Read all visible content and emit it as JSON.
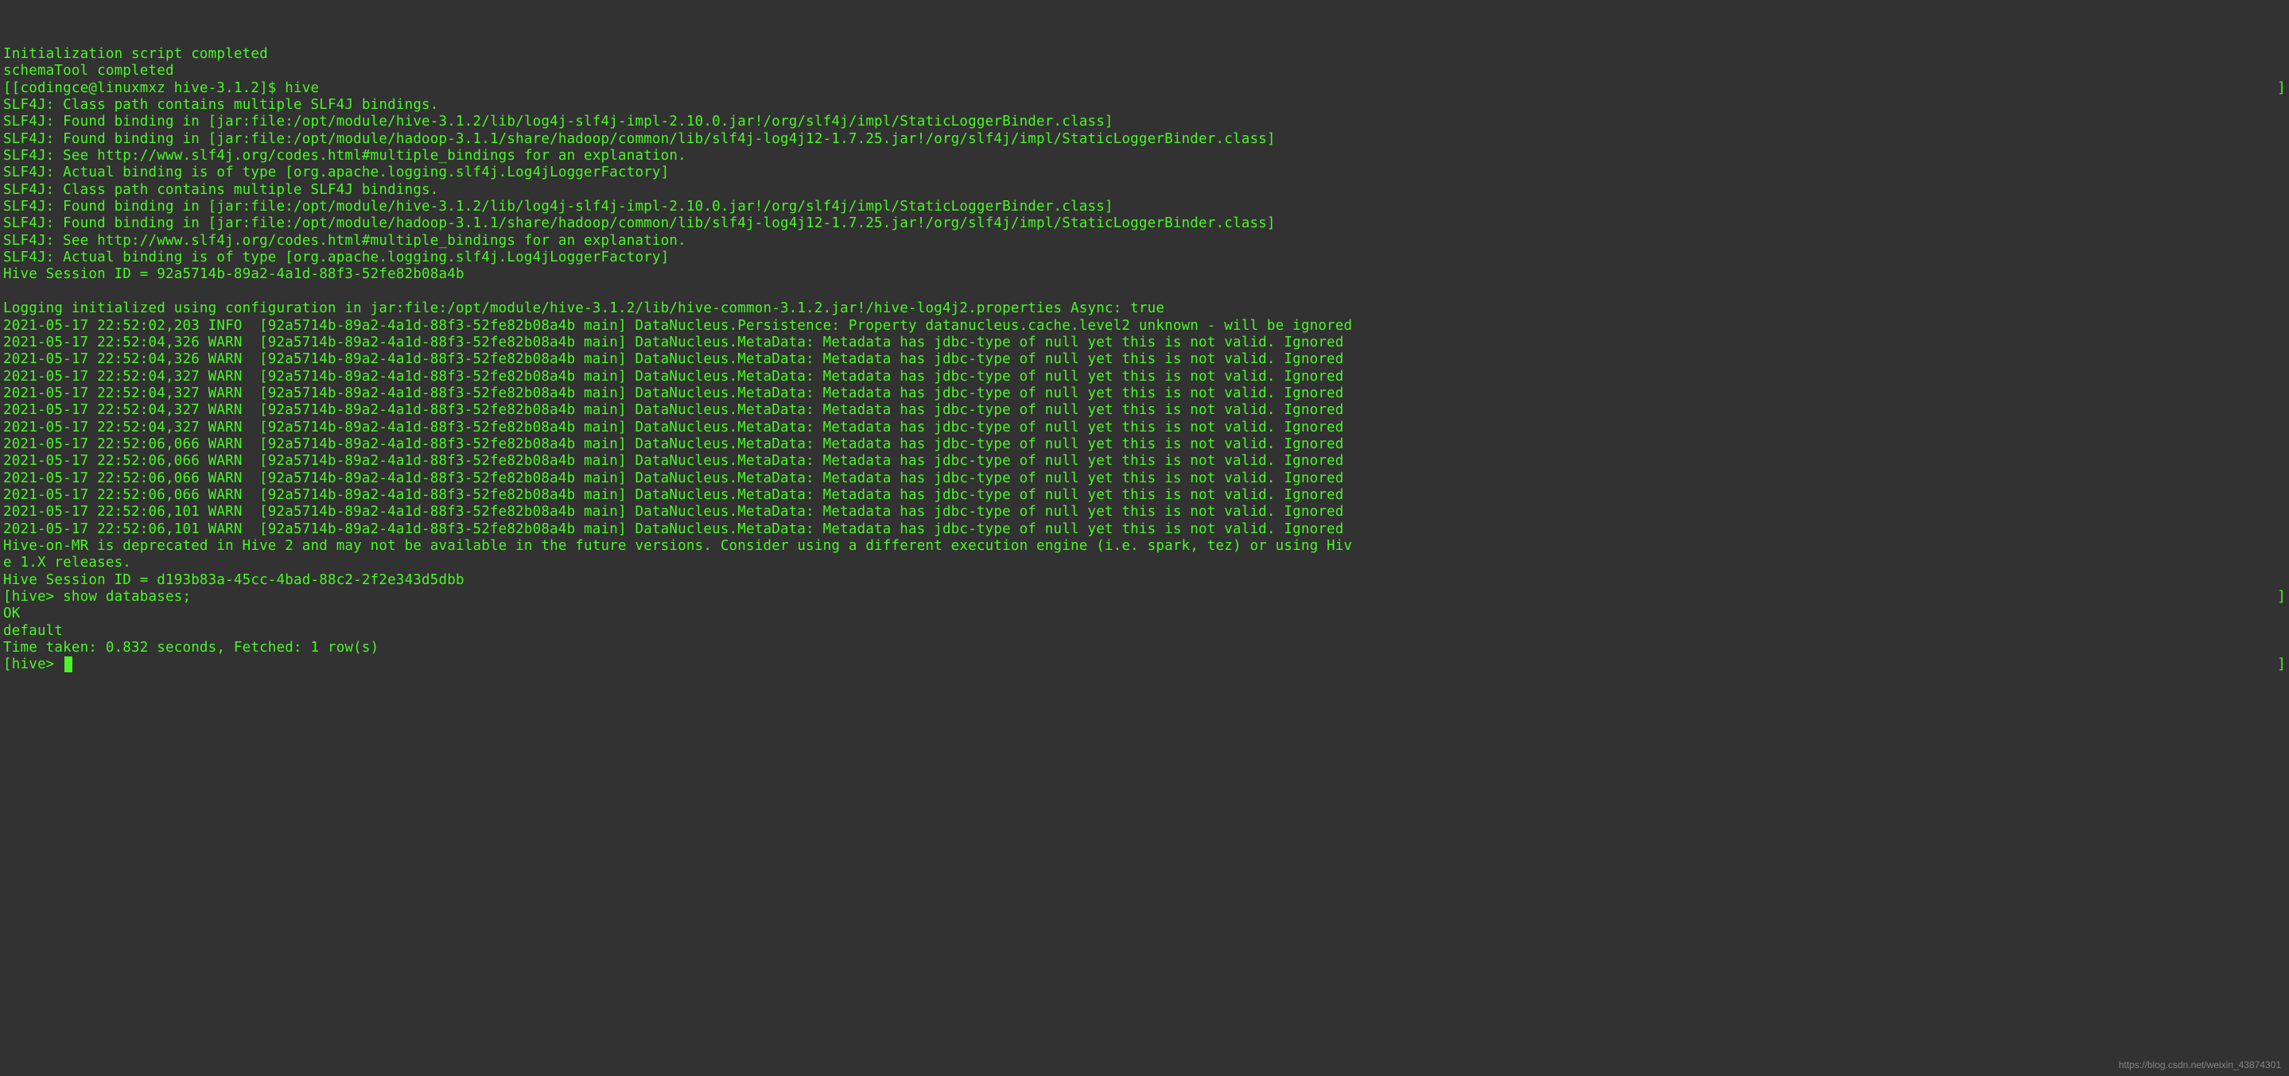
{
  "lines": [
    {
      "t": "Initialization script completed"
    },
    {
      "t": "schemaTool completed"
    },
    {
      "t": "[[codingce@linuxmxz hive-3.1.2]$ hive",
      "rb": true
    },
    {
      "t": "SLF4J: Class path contains multiple SLF4J bindings."
    },
    {
      "t": "SLF4J: Found binding in [jar:file:/opt/module/hive-3.1.2/lib/log4j-slf4j-impl-2.10.0.jar!/org/slf4j/impl/StaticLoggerBinder.class]"
    },
    {
      "t": "SLF4J: Found binding in [jar:file:/opt/module/hadoop-3.1.1/share/hadoop/common/lib/slf4j-log4j12-1.7.25.jar!/org/slf4j/impl/StaticLoggerBinder.class]"
    },
    {
      "t": "SLF4J: See http://www.slf4j.org/codes.html#multiple_bindings for an explanation."
    },
    {
      "t": "SLF4J: Actual binding is of type [org.apache.logging.slf4j.Log4jLoggerFactory]"
    },
    {
      "t": "SLF4J: Class path contains multiple SLF4J bindings."
    },
    {
      "t": "SLF4J: Found binding in [jar:file:/opt/module/hive-3.1.2/lib/log4j-slf4j-impl-2.10.0.jar!/org/slf4j/impl/StaticLoggerBinder.class]"
    },
    {
      "t": "SLF4J: Found binding in [jar:file:/opt/module/hadoop-3.1.1/share/hadoop/common/lib/slf4j-log4j12-1.7.25.jar!/org/slf4j/impl/StaticLoggerBinder.class]"
    },
    {
      "t": "SLF4J: See http://www.slf4j.org/codes.html#multiple_bindings for an explanation."
    },
    {
      "t": "SLF4J: Actual binding is of type [org.apache.logging.slf4j.Log4jLoggerFactory]"
    },
    {
      "t": "Hive Session ID = 92a5714b-89a2-4a1d-88f3-52fe82b08a4b"
    },
    {
      "t": "",
      "blank": true
    },
    {
      "t": "Logging initialized using configuration in jar:file:/opt/module/hive-3.1.2/lib/hive-common-3.1.2.jar!/hive-log4j2.properties Async: true"
    },
    {
      "t": "2021-05-17 22:52:02,203 INFO  [92a5714b-89a2-4a1d-88f3-52fe82b08a4b main] DataNucleus.Persistence: Property datanucleus.cache.level2 unknown - will be ignored"
    },
    {
      "t": "2021-05-17 22:52:04,326 WARN  [92a5714b-89a2-4a1d-88f3-52fe82b08a4b main] DataNucleus.MetaData: Metadata has jdbc-type of null yet this is not valid. Ignored"
    },
    {
      "t": "2021-05-17 22:52:04,326 WARN  [92a5714b-89a2-4a1d-88f3-52fe82b08a4b main] DataNucleus.MetaData: Metadata has jdbc-type of null yet this is not valid. Ignored"
    },
    {
      "t": "2021-05-17 22:52:04,327 WARN  [92a5714b-89a2-4a1d-88f3-52fe82b08a4b main] DataNucleus.MetaData: Metadata has jdbc-type of null yet this is not valid. Ignored"
    },
    {
      "t": "2021-05-17 22:52:04,327 WARN  [92a5714b-89a2-4a1d-88f3-52fe82b08a4b main] DataNucleus.MetaData: Metadata has jdbc-type of null yet this is not valid. Ignored"
    },
    {
      "t": "2021-05-17 22:52:04,327 WARN  [92a5714b-89a2-4a1d-88f3-52fe82b08a4b main] DataNucleus.MetaData: Metadata has jdbc-type of null yet this is not valid. Ignored"
    },
    {
      "t": "2021-05-17 22:52:04,327 WARN  [92a5714b-89a2-4a1d-88f3-52fe82b08a4b main] DataNucleus.MetaData: Metadata has jdbc-type of null yet this is not valid. Ignored"
    },
    {
      "t": "2021-05-17 22:52:06,066 WARN  [92a5714b-89a2-4a1d-88f3-52fe82b08a4b main] DataNucleus.MetaData: Metadata has jdbc-type of null yet this is not valid. Ignored"
    },
    {
      "t": "2021-05-17 22:52:06,066 WARN  [92a5714b-89a2-4a1d-88f3-52fe82b08a4b main] DataNucleus.MetaData: Metadata has jdbc-type of null yet this is not valid. Ignored"
    },
    {
      "t": "2021-05-17 22:52:06,066 WARN  [92a5714b-89a2-4a1d-88f3-52fe82b08a4b main] DataNucleus.MetaData: Metadata has jdbc-type of null yet this is not valid. Ignored"
    },
    {
      "t": "2021-05-17 22:52:06,066 WARN  [92a5714b-89a2-4a1d-88f3-52fe82b08a4b main] DataNucleus.MetaData: Metadata has jdbc-type of null yet this is not valid. Ignored"
    },
    {
      "t": "2021-05-17 22:52:06,101 WARN  [92a5714b-89a2-4a1d-88f3-52fe82b08a4b main] DataNucleus.MetaData: Metadata has jdbc-type of null yet this is not valid. Ignored"
    },
    {
      "t": "2021-05-17 22:52:06,101 WARN  [92a5714b-89a2-4a1d-88f3-52fe82b08a4b main] DataNucleus.MetaData: Metadata has jdbc-type of null yet this is not valid. Ignored"
    },
    {
      "t": "Hive-on-MR is deprecated in Hive 2 and may not be available in the future versions. Consider using a different execution engine (i.e. spark, tez) or using Hiv"
    },
    {
      "t": "e 1.X releases."
    },
    {
      "t": "Hive Session ID = d193b83a-45cc-4bad-88c2-2f2e343d5dbb"
    },
    {
      "t": "[hive> show databases;",
      "rb": true
    },
    {
      "t": "OK"
    },
    {
      "t": "default"
    },
    {
      "t": "Time taken: 0.832 seconds, Fetched: 1 row(s)"
    },
    {
      "t": "[hive> ",
      "cursor": true,
      "rb": true
    }
  ],
  "watermark": "https://blog.csdn.net/weixin_43874301"
}
